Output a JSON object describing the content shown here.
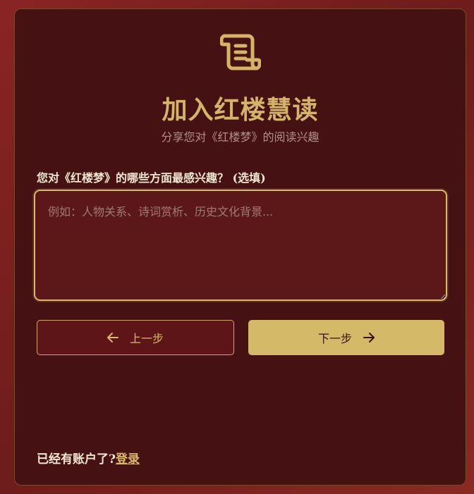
{
  "header": {
    "logo_icon": "scroll-icon",
    "title": "加入红楼慧读",
    "subtitle": "分享您对《红楼梦》的阅读兴趣"
  },
  "form": {
    "interest_label": "您对《红楼梦》的哪些方面最感兴趣？ (选填)",
    "interest_placeholder": "例如：人物关系、诗词赏析、历史文化背景...",
    "interest_value": ""
  },
  "buttons": {
    "prev_label": "上一步",
    "prev_icon": "arrow-left-icon",
    "next_label": "下一步",
    "next_icon": "arrow-right-icon"
  },
  "footer": {
    "prompt": "已经有账户了?",
    "login_label": "登录"
  },
  "colors": {
    "accent": "#d4b968",
    "card_bg": "#451112",
    "page_bg": "#7a2020",
    "input_bg": "#5c1719"
  }
}
